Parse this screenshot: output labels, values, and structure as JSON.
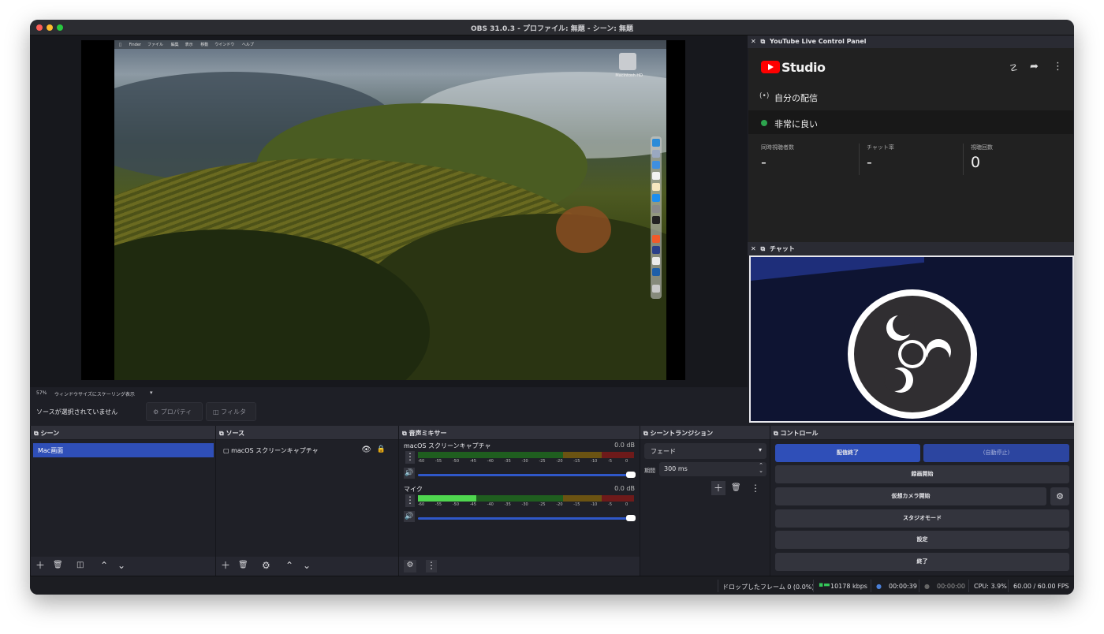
{
  "window": {
    "title": "OBS 31.0.3 - プロファイル: 無題 - シーン: 無題"
  },
  "preview": {
    "zoom": "57%",
    "scale_mode": "ウィンドウサイズにスケーリング表示",
    "desktop_menu": [
      "Finder",
      "ファイル",
      "編集",
      "表示",
      "移動",
      "ウインドウ",
      "ヘルプ"
    ],
    "desktop_hd_label": "Macintosh HD"
  },
  "source_toolbar": {
    "no_selection": "ソースが選択されていません",
    "properties": "プロパティ",
    "filters": "フィルタ"
  },
  "docks": {
    "youtube": {
      "title": "YouTube Live Control Panel",
      "brand": "Studio",
      "my_stream": "自分の配信",
      "health": "非常に良い",
      "stats": [
        {
          "label": "同時視聴者数",
          "value": "-"
        },
        {
          "label": "チャット率",
          "value": "-"
        },
        {
          "label": "視聴回数",
          "value": "0"
        }
      ]
    },
    "chat": {
      "title": "チャット"
    }
  },
  "scenes": {
    "title": "シーン",
    "items": [
      "Mac画面"
    ]
  },
  "sources": {
    "title": "ソース",
    "items": [
      "macOS スクリーンキャプチャ"
    ]
  },
  "mixer": {
    "title": "音声ミキサー",
    "channels": [
      {
        "name": "macOS スクリーンキャプチャ",
        "db": "0.0 dB",
        "level": 0.0
      },
      {
        "name": "マイク",
        "db": "0.0 dB",
        "level": 0.27
      }
    ],
    "scale": [
      "-60",
      "-55",
      "-50",
      "-45",
      "-40",
      "-35",
      "-30",
      "-25",
      "-20",
      "-15",
      "-10",
      "-5",
      "0"
    ]
  },
  "transitions": {
    "title": "シーントランジション",
    "type": "フェード",
    "duration_label": "期間",
    "duration": "300 ms"
  },
  "controls": {
    "title": "コントロール",
    "stop_stream": "配信終了",
    "auto_stop": "(自動停止)",
    "start_recording": "録画開始",
    "start_virtualcam": "仮想カメラ開始",
    "studio_mode": "スタジオモード",
    "settings": "設定",
    "exit": "終了"
  },
  "status": {
    "dropped": "ドロップしたフレーム 0 (0.0%)",
    "bitrate": "10178 kbps",
    "stream_time": "00:00:39",
    "rec_time": "00:00:00",
    "cpu": "CPU: 3.9%",
    "fps": "60.00 / 60.00 FPS"
  },
  "colors": {
    "accent": "#2f4fb8",
    "live": "#2da44e",
    "yt_red": "#ff0000"
  }
}
